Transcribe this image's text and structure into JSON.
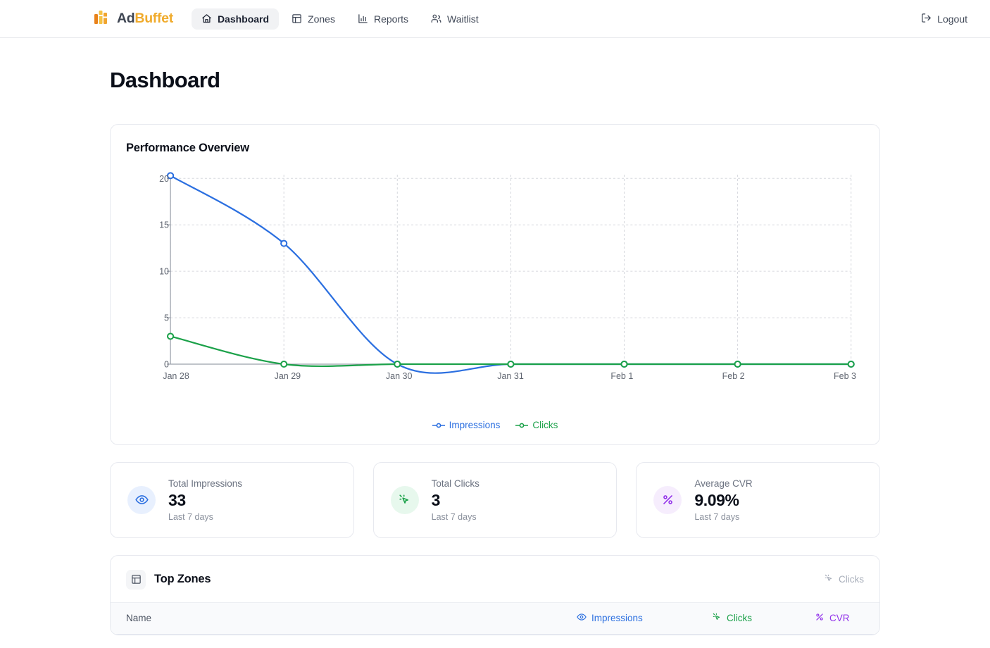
{
  "brand": {
    "name_first": "Ad",
    "name_second": "Buffet",
    "icon": "bar-chart-logo-icon"
  },
  "nav": {
    "items": [
      {
        "label": "Dashboard",
        "icon": "home-icon",
        "active": true
      },
      {
        "label": "Zones",
        "icon": "panel-layout-icon",
        "active": false
      },
      {
        "label": "Reports",
        "icon": "bar-chart-icon",
        "active": false
      },
      {
        "label": "Waitlist",
        "icon": "users-icon",
        "active": false
      }
    ],
    "logout_label": "Logout",
    "logout_icon": "log-out-icon"
  },
  "page": {
    "title": "Dashboard"
  },
  "performance": {
    "title": "Performance Overview"
  },
  "chart_data": {
    "type": "line",
    "title": "Performance Overview",
    "xlabel": "",
    "ylabel": "",
    "x": [
      "Jan 28",
      "Jan 29",
      "Jan 30",
      "Jan 31",
      "Feb 1",
      "Feb 2",
      "Feb 3"
    ],
    "yticks": [
      0,
      5,
      10,
      15,
      20
    ],
    "ylim": [
      0,
      20.4
    ],
    "grid": true,
    "legend_position": "bottom-center",
    "series": [
      {
        "name": "Impressions",
        "color": "#2b6fe0",
        "values": [
          20.3,
          13,
          0,
          0,
          0,
          0,
          0
        ]
      },
      {
        "name": "Clicks",
        "color": "#1ba149",
        "values": [
          3,
          0,
          0,
          0,
          0,
          0,
          0
        ]
      }
    ]
  },
  "stats": [
    {
      "label": "Total Impressions",
      "value": "33",
      "sub": "Last 7 days",
      "icon": "eye-icon",
      "tone": "blue",
      "color": "#2b6fe0"
    },
    {
      "label": "Total Clicks",
      "value": "3",
      "sub": "Last 7 days",
      "icon": "mouse-pointer-click-icon",
      "tone": "green",
      "color": "#1ba149"
    },
    {
      "label": "Average CVR",
      "value": "9.09%",
      "sub": "Last 7 days",
      "icon": "percent-icon",
      "tone": "purple",
      "color": "#9333ea"
    }
  ],
  "top_zones": {
    "title": "Top Zones",
    "title_icon": "panel-layout-icon",
    "header_right_label": "Clicks",
    "header_right_icon": "mouse-pointer-click-icon",
    "columns": [
      {
        "label": "Name",
        "icon": null,
        "color": "#4b5361"
      },
      {
        "label": "Impressions",
        "icon": "eye-icon",
        "color": "#2b6fe0"
      },
      {
        "label": "Clicks",
        "icon": "mouse-pointer-click-icon",
        "color": "#1ba149"
      },
      {
        "label": "CVR",
        "icon": "percent-icon",
        "color": "#9333ea"
      }
    ],
    "rows": []
  }
}
